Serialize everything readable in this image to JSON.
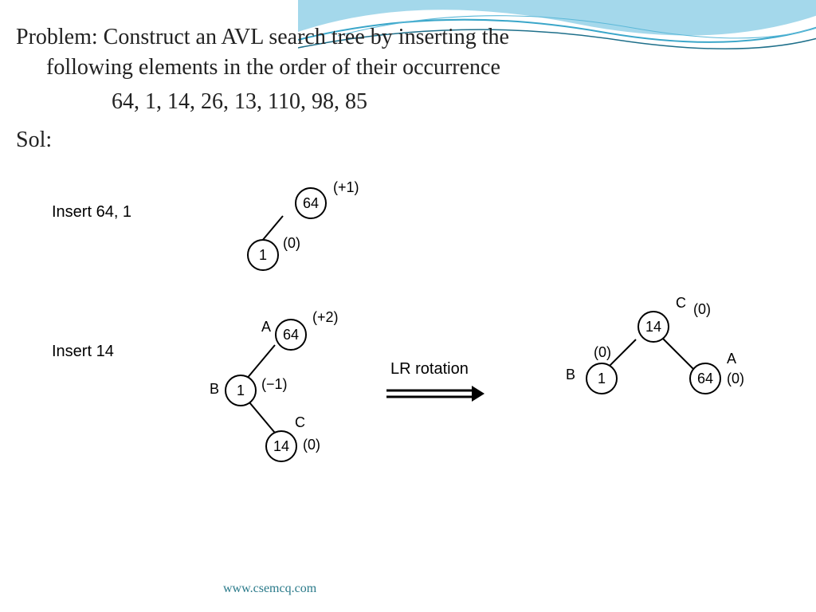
{
  "problem": {
    "line1": "Problem: Construct an AVL search tree by inserting the",
    "line2": "following elements in the order of their occurrence",
    "numbers": "64, 1, 14, 26, 13, 110, 98, 85",
    "sol": "Sol:"
  },
  "steps": {
    "step1": "Insert 64, 1",
    "step2": "Insert 14"
  },
  "tree1": {
    "n64": "64",
    "n64_bal": "(+1)",
    "n1": "1",
    "n1_bal": "(0)"
  },
  "tree2": {
    "nA": "A",
    "n64": "64",
    "n64_bal": "(+2)",
    "nB": "B",
    "n1": "1",
    "n1_bal": "(−1)",
    "nC": "C",
    "n14": "14",
    "n14_bal": "(0)"
  },
  "rotation": "LR rotation",
  "tree3": {
    "nC": "C",
    "n14": "14",
    "n14_bal": "(0)",
    "nB": "B",
    "n1": "1",
    "n1_bal": "(0)",
    "nA": "A",
    "n64": "64",
    "n64_bal": "(0)"
  },
  "footer": "www.csemcq.com"
}
